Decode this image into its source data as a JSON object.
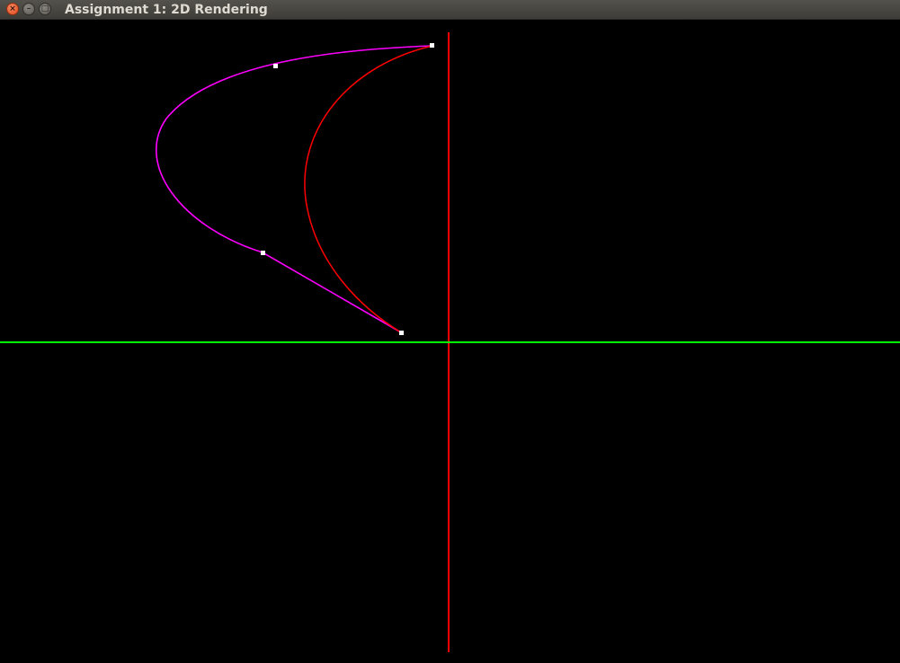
{
  "window": {
    "title": "Assignment 1: 2D Rendering",
    "controls": {
      "close_icon": "×",
      "minimize_icon": "–",
      "maximize_icon": "□"
    }
  },
  "scene": {
    "background_color": "#000000",
    "y_axis_color": "#ff0000",
    "x_axis_color": "#00ff00",
    "bezier_curve_color": "#ff00ff",
    "red_curve_color": "#ff0000",
    "control_point_color": "#ffffff",
    "control_point_count": 4
  }
}
